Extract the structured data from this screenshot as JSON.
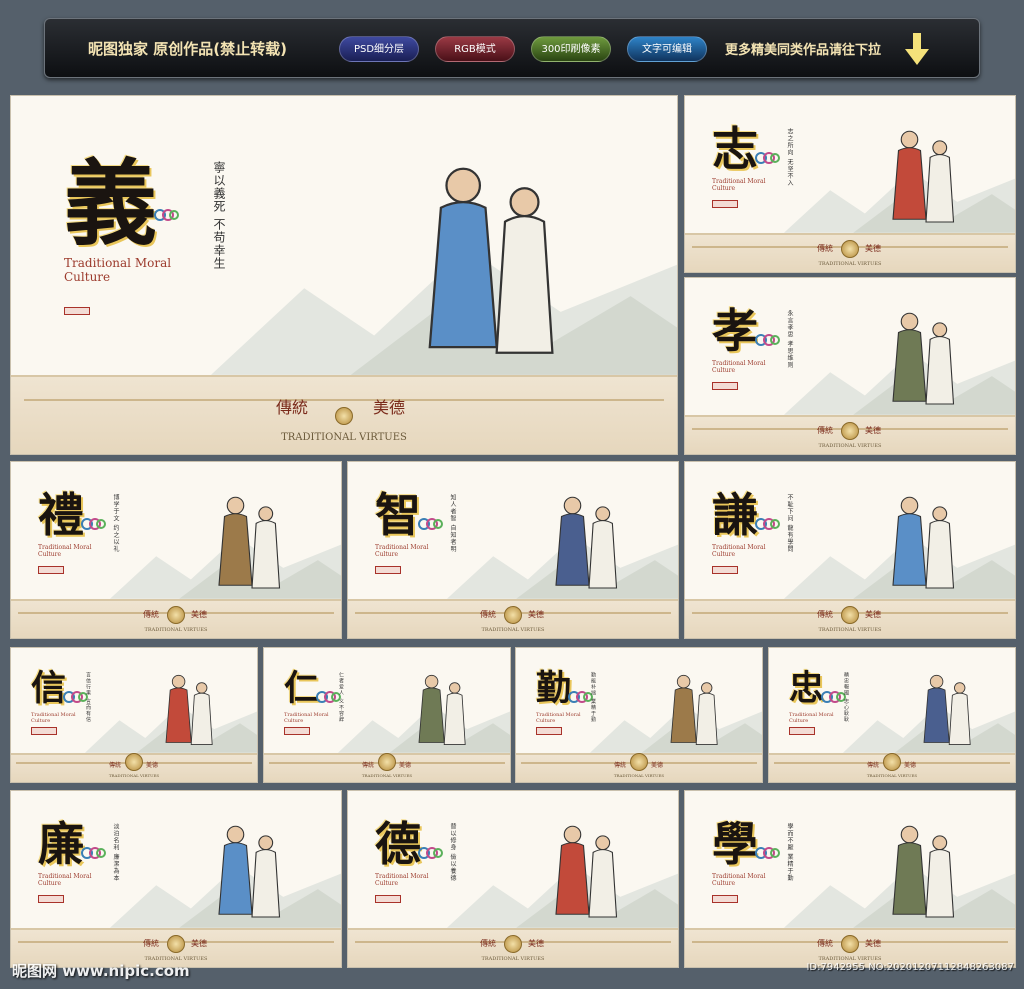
{
  "toolbar": {
    "brand": "昵图独家 原创作品(禁止转载)",
    "badges": [
      "PSD细分层",
      "RGB模式",
      "300印刷像素",
      "文字可编辑"
    ],
    "more": "更多精美同类作品请往下拉"
  },
  "cards": [
    {
      "glyph": "義",
      "poem": "寧以義死  不苟幸生",
      "en": "Traditional Moral Culture",
      "seal": "德育文化",
      "motto_left": "傳統",
      "motto_right": "美德",
      "tv": "TRADITIONAL VIRTUES"
    },
    {
      "glyph": "志",
      "poem": "志之所向  无坚不入",
      "en": "Traditional Moral Culture",
      "seal": "德育文化",
      "motto_left": "傳統",
      "motto_right": "美德",
      "tv": "TRADITIONAL VIRTUES"
    },
    {
      "glyph": "孝",
      "poem": "永言孝思  孝思维则",
      "en": "Traditional Moral Culture",
      "seal": "德育文化",
      "motto_left": "傳統",
      "motto_right": "美德",
      "tv": "TRADITIONAL VIRTUES"
    },
    {
      "glyph": "禮",
      "poem": "博学于文  约之以礼",
      "en": "Traditional Moral Culture",
      "seal": "德育文化",
      "motto_left": "傳統",
      "motto_right": "美德",
      "tv": "TRADITIONAL VIRTUES"
    },
    {
      "glyph": "智",
      "poem": "知人者智  自知者明",
      "en": "Traditional Moral Culture",
      "seal": "德育文化",
      "motto_left": "傳統",
      "motto_right": "美德",
      "tv": "TRADITIONAL VIRTUES"
    },
    {
      "glyph": "謙",
      "poem": "不耻下问  龍有學問",
      "en": "Traditional Moral Culture",
      "seal": "德育文化",
      "motto_left": "傳統",
      "motto_right": "美德",
      "tv": "TRADITIONAL VIRTUES"
    },
    {
      "glyph": "信",
      "poem": "言信行果  言而有信",
      "en": "Traditional Moral Culture",
      "seal": "德育文化",
      "motto_left": "傳統",
      "motto_right": "美德",
      "tv": "TRADITIONAL VIRTUES"
    },
    {
      "glyph": "仁",
      "poem": "仁者爱人  义不容辞",
      "en": "Traditional Moral Culture",
      "seal": "德育文化",
      "motto_left": "傳統",
      "motto_right": "美德",
      "tv": "TRADITIONAL VIRTUES"
    },
    {
      "glyph": "勤",
      "poem": "勤能补拙  業精于勤",
      "en": "Traditional Moral Culture",
      "seal": "德育文化",
      "motto_left": "傳統",
      "motto_right": "美德",
      "tv": "TRADITIONAL VIRTUES"
    },
    {
      "glyph": "忠",
      "poem": "精忠報國  忠心耿耿",
      "en": "Traditional Moral Culture",
      "seal": "德育文化",
      "motto_left": "傳統",
      "motto_right": "美德",
      "tv": "TRADITIONAL VIRTUES"
    },
    {
      "glyph": "廉",
      "poem": "淡泊名利  廉潔為本",
      "en": "Traditional Moral Culture",
      "seal": "德育文化",
      "motto_left": "傳統",
      "motto_right": "美德",
      "tv": "TRADITIONAL VIRTUES"
    },
    {
      "glyph": "德",
      "poem": "替以修身  儉以養德",
      "en": "Traditional Moral Culture",
      "seal": "德育文化",
      "motto_left": "傳統",
      "motto_right": "美德",
      "tv": "TRADITIONAL VIRTUES"
    },
    {
      "glyph": "學",
      "poem": "學而不厭  業精于勤",
      "en": "Traditional Moral Culture",
      "seal": "德育文化",
      "motto_left": "傳統",
      "motto_right": "美德",
      "tv": "TRADITIONAL VIRTUES"
    }
  ],
  "watermark": {
    "left": "昵图网 www.nipic.com",
    "right": "ID:7942955 NO:20201207112848263087"
  },
  "colors": {
    "background": "#55606b",
    "card": "#fbf8f1",
    "glyph_gold": "#e9c65a",
    "accent_red": "#a8322a"
  }
}
